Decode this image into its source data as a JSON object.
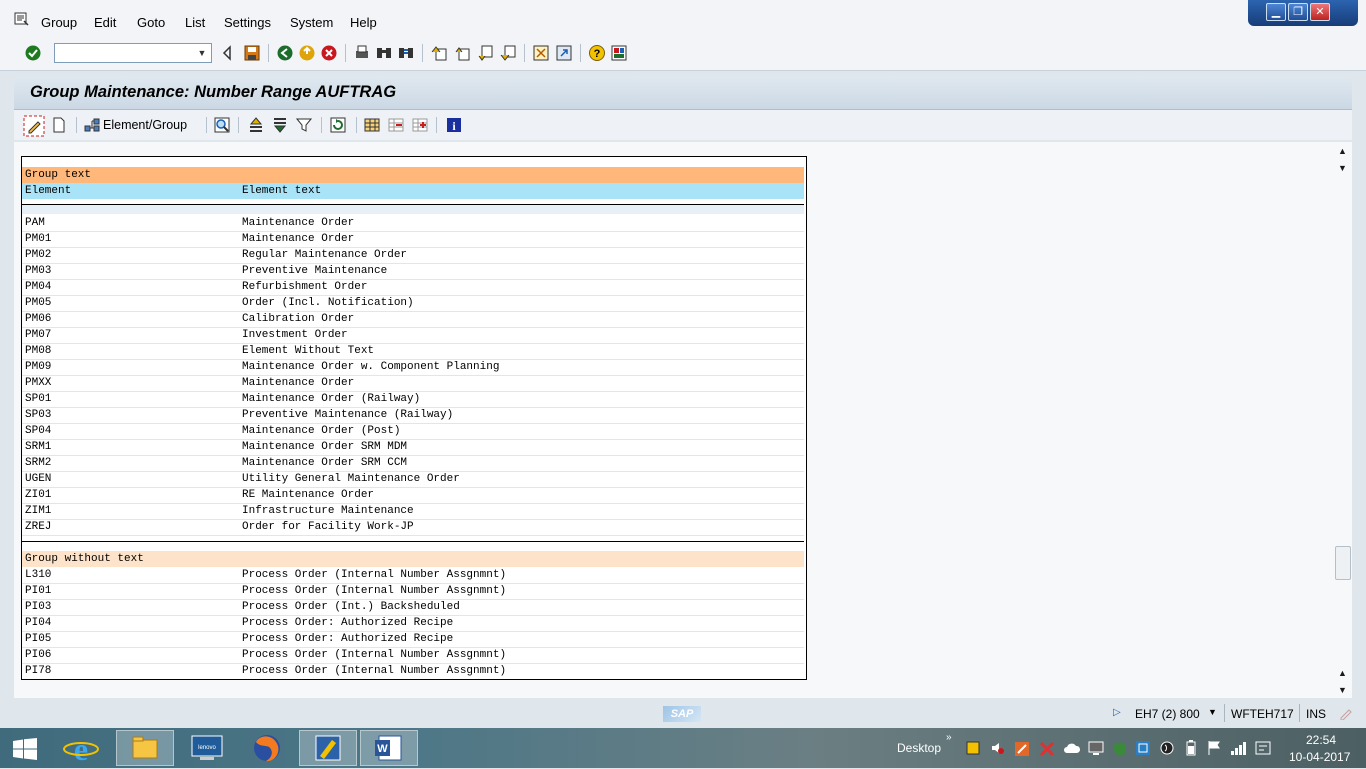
{
  "menubar": {
    "items": [
      "Group",
      "Edit",
      "Goto",
      "List",
      "Settings",
      "System",
      "Help"
    ]
  },
  "window_controls": {
    "minimize": "▁",
    "restore": "❐",
    "close": "✕"
  },
  "command_field": {
    "value": ""
  },
  "title": "Group Maintenance: Number Range AUFTRAG",
  "app_toolbar": {
    "element_group_label": "Element/Group"
  },
  "list": {
    "group_text_header": "Group text",
    "column_headers": {
      "element": "Element",
      "element_text": "Element text"
    },
    "group_rows": [
      {
        "element": "PAM",
        "text": "Maintenance Order"
      },
      {
        "element": "PM01",
        "text": "Maintenance Order"
      },
      {
        "element": "PM02",
        "text": "Regular Maintenance Order"
      },
      {
        "element": "PM03",
        "text": "Preventive Maintenance"
      },
      {
        "element": "PM04",
        "text": "Refurbishment Order"
      },
      {
        "element": "PM05",
        "text": "Order (Incl. Notification)"
      },
      {
        "element": "PM06",
        "text": "Calibration Order"
      },
      {
        "element": "PM07",
        "text": "Investment Order"
      },
      {
        "element": "PM08",
        "text": "Element Without Text"
      },
      {
        "element": "PM09",
        "text": "Maintenance Order w. Component Planning"
      },
      {
        "element": "PMXX",
        "text": "Maintenance Order"
      },
      {
        "element": "SP01",
        "text": "Maintenance Order (Railway)"
      },
      {
        "element": "SP03",
        "text": "Preventive Maintenance (Railway)"
      },
      {
        "element": "SP04",
        "text": "Maintenance Order (Post)"
      },
      {
        "element": "SRM1",
        "text": "Maintenance Order SRM MDM"
      },
      {
        "element": "SRM2",
        "text": "Maintenance Order SRM CCM"
      },
      {
        "element": "UGEN",
        "text": "Utility General Maintenance Order"
      },
      {
        "element": "ZI01",
        "text": "RE Maintenance Order"
      },
      {
        "element": "ZIM1",
        "text": "Infrastructure Maintenance"
      },
      {
        "element": "ZREJ",
        "text": "Order for Facility Work-JP"
      }
    ],
    "group_without_text_header": "Group without text",
    "nogroup_rows": [
      {
        "element": "L310",
        "text": "Process Order (Internal Number Assgnmnt)"
      },
      {
        "element": "PI01",
        "text": "Process Order (Internal Number Assgnmnt)"
      },
      {
        "element": "PI03",
        "text": "Process Order (Int.) Backsheduled"
      },
      {
        "element": "PI04",
        "text": "Process Order: Authorized Recipe"
      },
      {
        "element": "PI05",
        "text": "Process Order: Authorized Recipe"
      },
      {
        "element": "PI06",
        "text": "Process Order (Internal Number Assgnmnt)"
      },
      {
        "element": "PI78",
        "text": "Process Order (Internal Number Assgnmnt)"
      }
    ]
  },
  "status": {
    "sap_logo": "SAP",
    "system": "EH7 (2) 800",
    "server": "WFTEH717",
    "mode": "INS"
  },
  "taskbar": {
    "desktop_label": "Desktop",
    "time": "22:54",
    "date": "10-04-2017"
  },
  "colors": {
    "group_text_header": "#ffb87a",
    "column_header": "#a9e3f7",
    "group_without_text_header": "#fde3c9",
    "title_bar": "#cbd8e4"
  }
}
